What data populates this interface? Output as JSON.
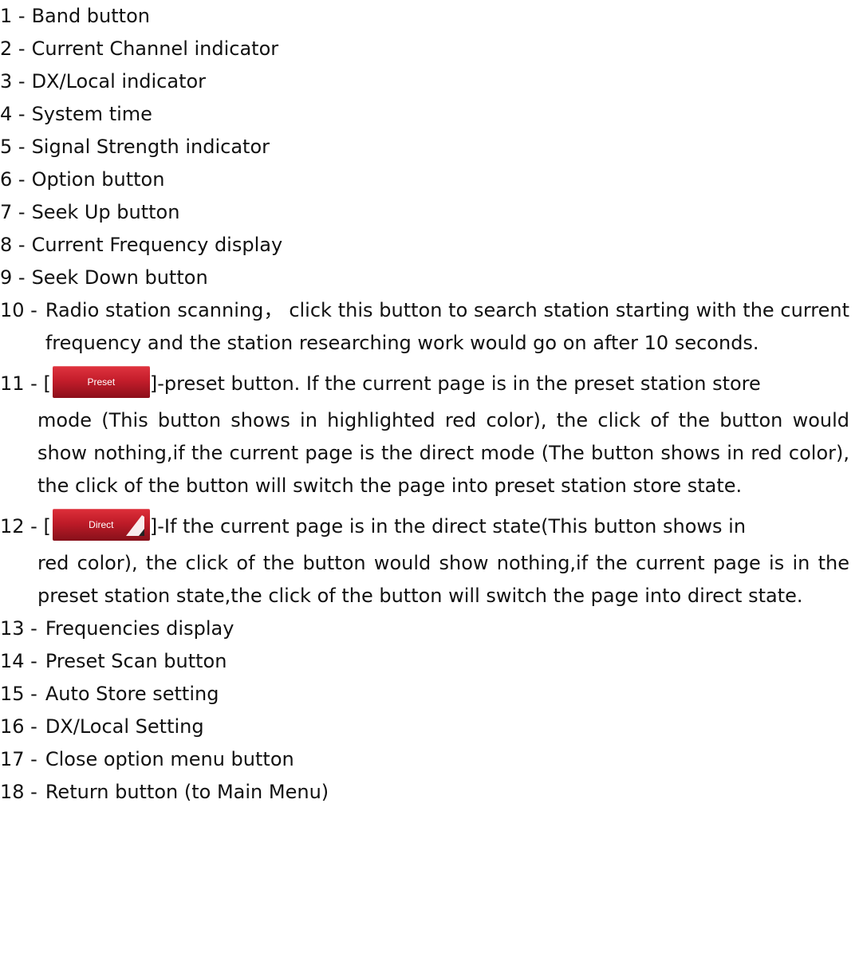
{
  "items": [
    {
      "num": "1 -",
      "text": "Band button"
    },
    {
      "num": "2 -",
      "text": "Current Channel indicator"
    },
    {
      "num": "3 -",
      "text": "DX/Local indicator"
    },
    {
      "num": "4 -",
      "text": "System time"
    },
    {
      "num": "5 -",
      "text": "Signal Strength indicator"
    },
    {
      "num": "6 -",
      "text": "Option button"
    },
    {
      "num": "7 -",
      "text": "Seek Up button"
    },
    {
      "num": "8 -",
      "text": "Current Frequency display"
    },
    {
      "num": "9 -",
      "text": "Seek Down button"
    }
  ],
  "item10": {
    "num": "10 -",
    "text": "Radio station scanning， click this button to search station starting with the current frequency and the station researching work would go on after 10 seconds."
  },
  "item11": {
    "num": "11 -",
    "open_bracket": "[",
    "button_label": "Preset",
    "lead_text": "]-preset button. If the current page is in the preset station store",
    "rest_text": "mode (This button shows in highlighted red color), the click of the button would show nothing,if the current page is the direct mode (The button shows in red color), the click of the button will switch the page into preset station store state."
  },
  "item12": {
    "num": "12 -",
    "open_bracket": "[",
    "button_label": "Direct",
    "lead_text": "]-If the current page is in the direct state(This button shows in",
    "rest_text": "red color), the click of the button would show nothing,if the current page is in the preset station state,the click of the button will switch the page into direct state."
  },
  "items_tail": [
    {
      "num": "13 -",
      "text": "Frequencies display"
    },
    {
      "num": "14 -",
      "text": "Preset Scan button"
    },
    {
      "num": "15 -",
      "text": "Auto Store setting"
    },
    {
      "num": "16 -",
      "text": "DX/Local Setting"
    },
    {
      "num": "17 -",
      "text": "Close option menu button"
    },
    {
      "num": "18 -",
      "text": "Return button (to Main Menu)"
    }
  ],
  "colors": {
    "button_red": "#c41d2b",
    "text": "#111111"
  }
}
